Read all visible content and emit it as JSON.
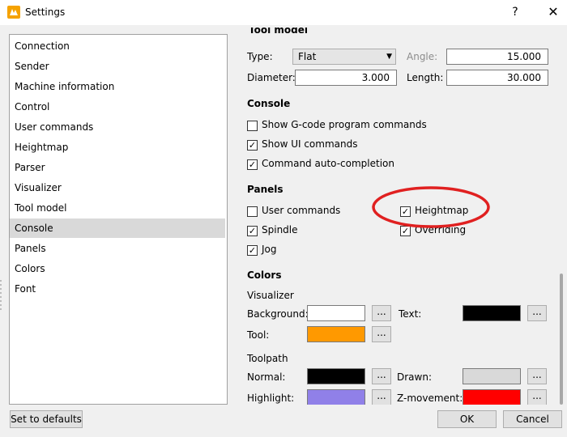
{
  "window": {
    "title": "Settings",
    "help_glyph": "?",
    "close_glyph": "✕"
  },
  "nav": {
    "items": [
      {
        "label": "Connection"
      },
      {
        "label": "Sender"
      },
      {
        "label": "Machine information"
      },
      {
        "label": "Control"
      },
      {
        "label": "User commands"
      },
      {
        "label": "Heightmap"
      },
      {
        "label": "Parser"
      },
      {
        "label": "Visualizer"
      },
      {
        "label": "Tool model"
      },
      {
        "label": "Console"
      },
      {
        "label": "Panels"
      },
      {
        "label": "Colors"
      },
      {
        "label": "Font"
      }
    ],
    "selected": "Console"
  },
  "tool_model": {
    "section_title": "Tool model",
    "type_label": "Type:",
    "type_value": "Flat",
    "angle_label": "Angle:",
    "angle_value": "15.000",
    "diameter_label": "Diameter:",
    "diameter_value": "3.000",
    "length_label": "Length:",
    "length_value": "30.000"
  },
  "console": {
    "section_title": "Console",
    "options": [
      {
        "label": "Show G-code program commands",
        "checked": false
      },
      {
        "label": "Show UI commands",
        "checked": true
      },
      {
        "label": "Command auto-completion",
        "checked": true
      }
    ]
  },
  "panels": {
    "section_title": "Panels",
    "options": [
      {
        "label": "User commands",
        "checked": false
      },
      {
        "label": "Heightmap",
        "checked": true
      },
      {
        "label": "Spindle",
        "checked": true
      },
      {
        "label": "Overriding",
        "checked": true
      },
      {
        "label": "Jog",
        "checked": true
      }
    ]
  },
  "colors": {
    "section_title": "Colors",
    "visualizer_group": "Visualizer",
    "toolpath_group": "Toolpath",
    "background_label": "Background:",
    "background_color": "#ffffff",
    "text_label": "Text:",
    "text_color": "#000000",
    "tool_label": "Tool:",
    "tool_color": "#ff9900",
    "normal_label": "Normal:",
    "normal_color": "#000000",
    "drawn_label": "Drawn:",
    "drawn_color": "#d9d9d9",
    "highlight_label": "Highlight:",
    "highlight_color": "#9080e8",
    "zmove_label": "Z-movement:",
    "zmove_color": "#ff0000",
    "dots_label": "..."
  },
  "footer": {
    "defaults_label": "Set to defaults",
    "ok_label": "OK",
    "cancel_label": "Cancel"
  },
  "check_glyph": "✓",
  "combo_arrow": "▼",
  "annotation_color": "#e02020"
}
